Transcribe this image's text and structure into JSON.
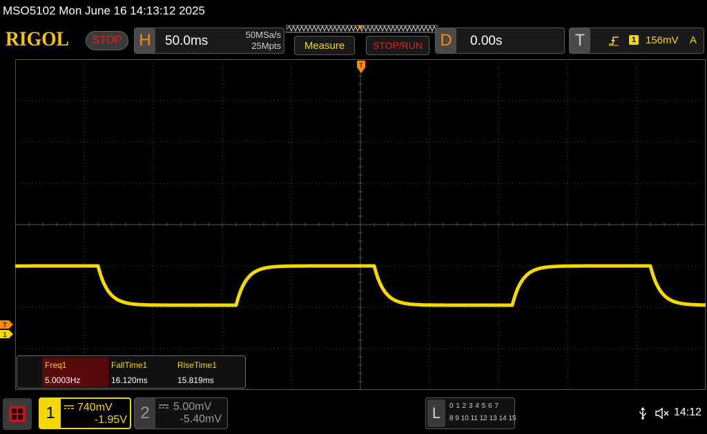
{
  "titlebar": {
    "text": "MSO5102  Mon June 16 14:13:12 2025"
  },
  "brand": {
    "logo": "RIGOL",
    "status": "STOP"
  },
  "horizontal": {
    "letter": "H",
    "timebase": "50.0ms",
    "sample_rate": "50MSa/s",
    "memory_depth": "25Mpts"
  },
  "toolbar": {
    "measure_label": "Measure",
    "stoprun_label": "STOP/RUN"
  },
  "delay": {
    "letter": "D",
    "value": "0.00s"
  },
  "trigger": {
    "letter": "T",
    "source": "1",
    "level": "156mV",
    "mode": "A",
    "edge_icon": "rising-edge-icon"
  },
  "markers": {
    "trigger_position": "T",
    "trigger_level": "T",
    "ch1_ground": "1"
  },
  "measurements": {
    "headers": [
      "Freq1",
      "FallTime1",
      "RiseTime1"
    ],
    "values": [
      "5.0003Hz",
      "16.120ms",
      "15.819ms"
    ]
  },
  "channels": [
    {
      "number": "1",
      "scale": "740mV",
      "offset": "-1.95V",
      "coupling": "dc-coupling-icon"
    },
    {
      "number": "2",
      "scale": "5.00mV",
      "offset": "-5.40mV",
      "coupling": "dc-coupling-icon"
    }
  ],
  "logic": {
    "letter": "L",
    "row1": "0 1 2 3   4 5 6 7",
    "row2": "8 9 10 11  12 13 14 15"
  },
  "status": {
    "time": "14:12",
    "usb_icon": "usb-icon",
    "sound_icon": "sound-muted-icon"
  },
  "colors": {
    "ch1": "#f5d800",
    "trigger": "#ff8c00",
    "stop": "#e02222",
    "grid": "#555555"
  },
  "waveform": {
    "frequency_hz": 5.0003,
    "low_divisions_from_bottom": 2.05,
    "high_divisions_from_bottom": 3.0,
    "first_rising_edge_ms": -90
  }
}
